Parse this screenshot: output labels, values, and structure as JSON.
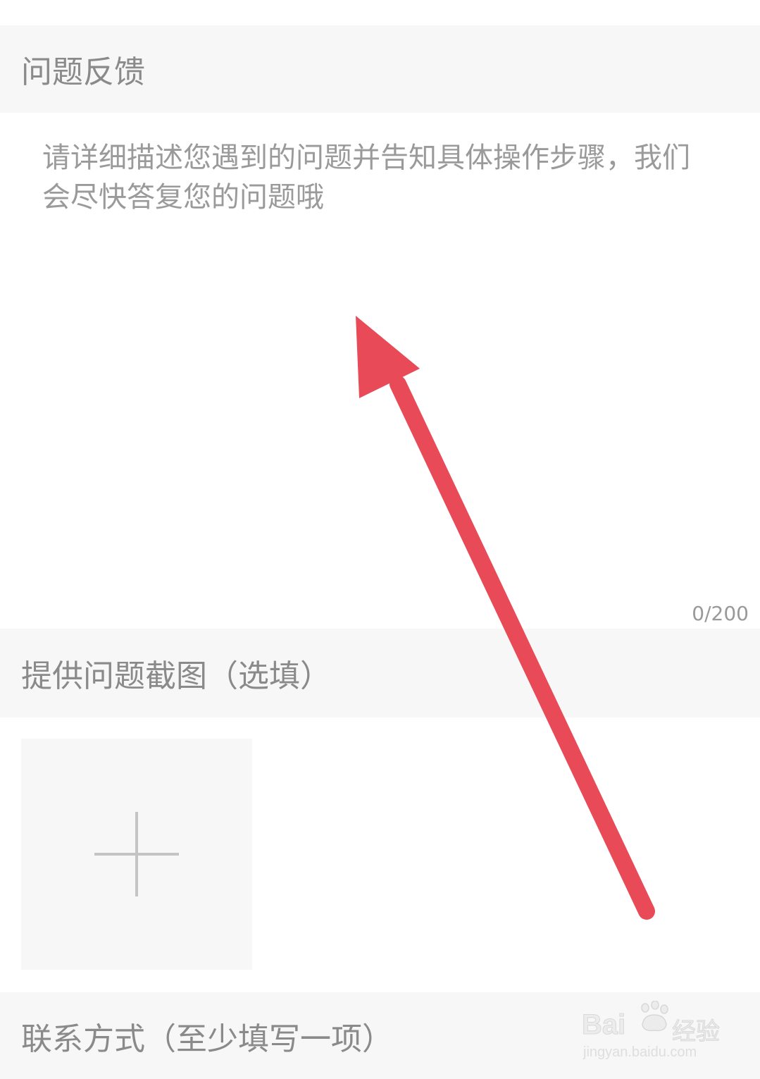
{
  "feedback": {
    "header": "问题反馈",
    "placeholder": "请详细描述您遇到的问题并告知具体操作步骤，我们会尽快答复您的问题哦",
    "counter": "0/200"
  },
  "screenshot": {
    "header": "提供问题截图（选填）",
    "add_icon": "plus-icon"
  },
  "contact": {
    "header": "联系方式（至少填写一项）"
  },
  "annotation": {
    "arrow_color": "#e94a57"
  },
  "watermark": {
    "brand": "Bai",
    "label": "经验",
    "url": "jingyan.baidu.com"
  }
}
